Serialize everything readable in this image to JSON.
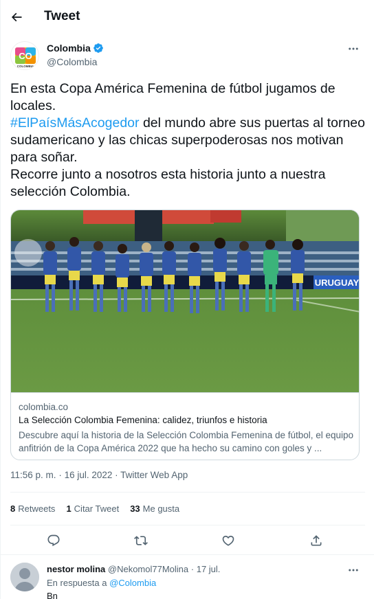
{
  "header": {
    "title": "Tweet"
  },
  "author": {
    "name": "Colombia",
    "handle": "@Colombia",
    "avatar_text": "CO",
    "avatar_sub": "COLOMBIA"
  },
  "tweet": {
    "line1": "En esta Copa América Femenina de fútbol jugamos de locales.",
    "hashtag": "#ElPaísMásAcogedor",
    "line2_rest": " del mundo abre sus puertas al torneo sudamericano y las chicas superpoderosas nos motivan para soñar.",
    "line3": "Recorre junto a nosotros esta historia junto a nuestra selección Colombia."
  },
  "card": {
    "image_banner": "URUGUAY",
    "domain": "colombia.co",
    "title": "La Selección Colombia Femenina: calidez, triunfos e historia",
    "description": "Descubre aquí la historia de la Selección Colombia Femenina de fútbol, el equipo anfitrión de la Copa América 2022 que ha hecho su camino con goles y ..."
  },
  "meta": {
    "time": "11:56 p. m.",
    "date": "16 jul. 2022",
    "source": "Twitter Web App",
    "separator": "·"
  },
  "stats": [
    {
      "num": "8",
      "label": "Retweets"
    },
    {
      "num": "1",
      "label": "Citar Tweet"
    },
    {
      "num": "33",
      "label": "Me gusta"
    }
  ],
  "actions": [
    "reply-icon",
    "retweet-icon",
    "like-icon",
    "share-icon"
  ],
  "reply": {
    "name": "nestor molina",
    "handle": "@Nekomol77Molina",
    "separator": "·",
    "date": "17 jul.",
    "replying_prefix": "En respuesta a",
    "replying_to": "@Colombia",
    "text": "Bn"
  },
  "colors": {
    "accent": "#1d9bf0",
    "text": "#0f1419",
    "secondary": "#536471",
    "border": "#cfd9de"
  }
}
